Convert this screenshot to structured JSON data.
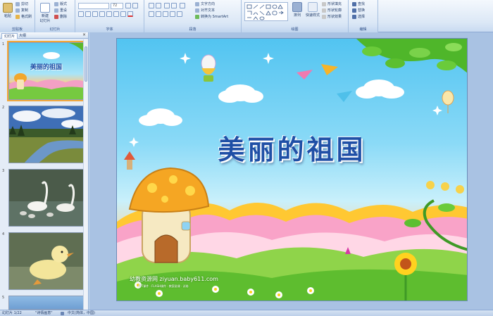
{
  "ribbon": {
    "clipboard": {
      "paste": "粘贴",
      "cut": "剪切",
      "copy": "复制",
      "format_painter": "格式刷",
      "group": "剪贴板"
    },
    "slides": {
      "new_slide": "新建\n幻灯片",
      "layout": "版式",
      "reset": "重设",
      "delete": "删除",
      "group": "幻灯片"
    },
    "font": {
      "font_size": "72",
      "group": "字体"
    },
    "paragraph": {
      "text_direction": "文字方向",
      "align_text": "对齐文本",
      "smartart": "转换为 SmartArt",
      "group": "段落"
    },
    "drawing": {
      "arrange": "排列",
      "quick_styles": "快速样式",
      "shape_fill": "形状填充",
      "shape_outline": "形状轮廓",
      "shape_effects": "形状效果",
      "group": "绘图"
    },
    "editing": {
      "find": "查找",
      "replace": "替换",
      "select": "选择",
      "group": "编辑"
    }
  },
  "panel": {
    "tabs": {
      "slides": "幻灯片",
      "outline": "大纲"
    },
    "close": "×",
    "thumbs": [
      {
        "num": "1",
        "title": "美丽的祖国"
      },
      {
        "num": "2"
      },
      {
        "num": "3"
      },
      {
        "num": "4"
      },
      {
        "num": "5"
      }
    ]
  },
  "slide": {
    "title": "美丽的祖国",
    "watermark": "幼教资源网 ziyuan.baby611.com",
    "watermark_sub": "PPT课件 · FLASH课件 · 教案说课 · 试卷"
  },
  "status": {
    "slide_pos": "幻灯片 1/22",
    "theme": "\"诗情画意\"",
    "language": "中文(简体，中国)"
  },
  "colors": {
    "title_blue": "#1f4fa6",
    "selection": "#f4a73a",
    "ribbon_bg": "#dce8f6"
  }
}
